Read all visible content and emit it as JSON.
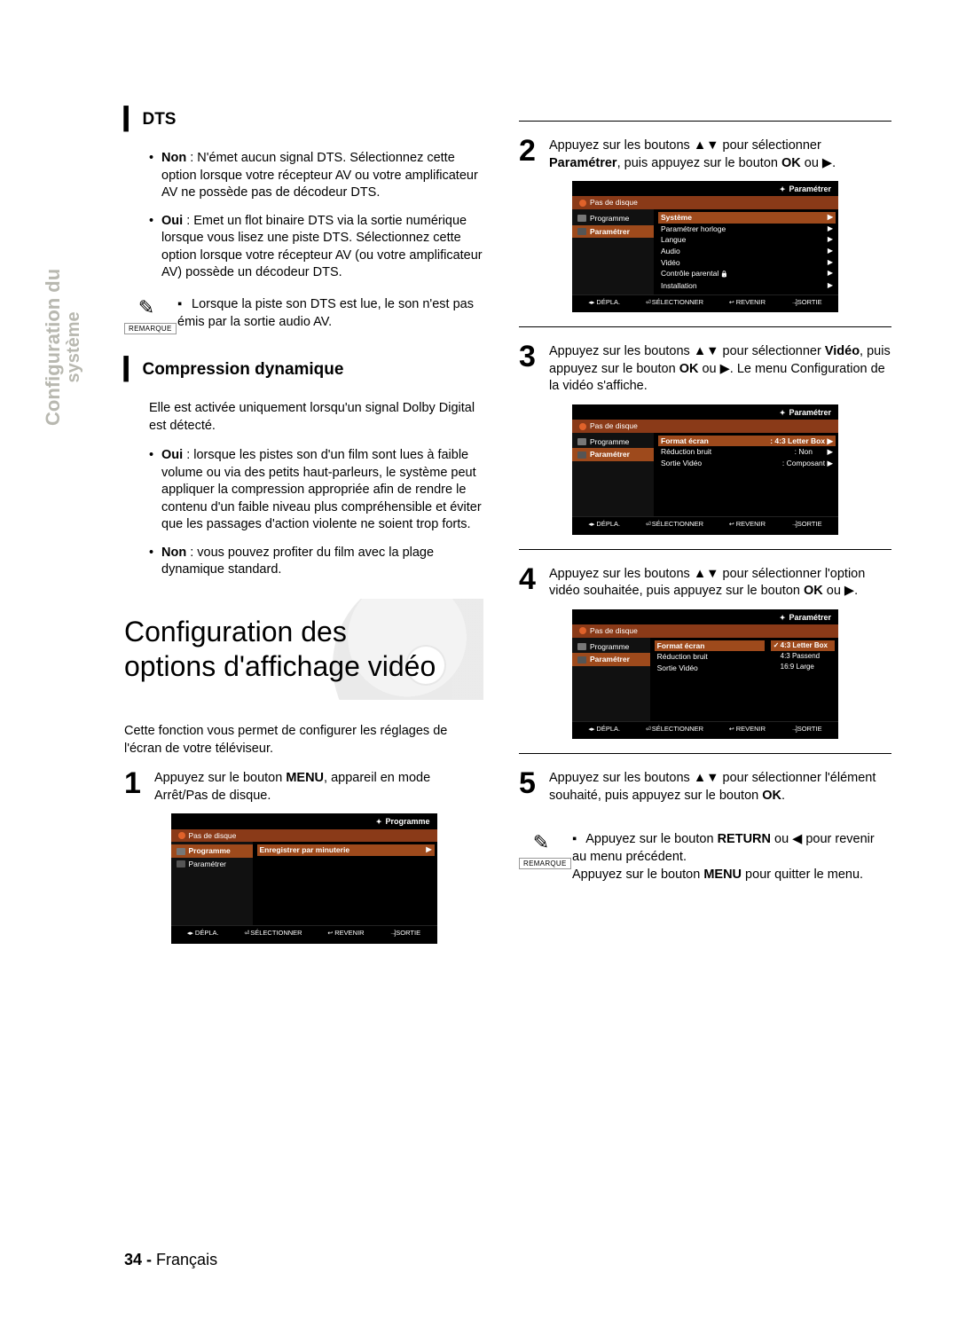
{
  "side_tab": {
    "line1": "Conﬁguration du",
    "line2": "système"
  },
  "left": {
    "dts_heading": "DTS",
    "dts_non_label": "Non",
    "dts_non_text": ": N'émet aucun signal DTS. Sélectionnez cette option lorsque votre récepteur AV ou votre ampliﬁcateur AV ne possède pas de décodeur DTS.",
    "dts_oui_label": "Oui",
    "dts_oui_text": ": Emet un ﬂot binaire DTS via la sortie numérique lorsque vous lisez une piste DTS. Sélectionnez cette option lorsque votre récepteur AV (ou votre ampliﬁcateur AV) possède un décodeur DTS.",
    "note_label": "REMARQUE",
    "dts_note": "Lorsque la piste son DTS est lue, le son n'est pas émis par la sortie audio AV.",
    "comp_heading": "Compression dynamique",
    "comp_intro": "Elle est activée uniquement lorsqu'un signal Dolby Digital est détecté.",
    "comp_oui_label": "Oui",
    "comp_oui_text": ": lorsque les pistes son d'un ﬁlm sont lues à faible volume ou via des petits haut-parleurs, le système peut appliquer la compression appropriée aﬁn de rendre le contenu d'un faible niveau plus compréhensible et éviter que les passages d'action violente ne soient trop forts.",
    "comp_non_label": "Non",
    "comp_non_text": ": vous pouvez proﬁter du ﬁlm avec la plage dynamique standard.",
    "big_title_l1": "Conﬁguration des",
    "big_title_l2": "options d'afﬁchage vidéo",
    "intro_text": "Cette fonction vous permet de conﬁgurer les réglages de l'écran de votre téléviseur.",
    "step1_pre": "Appuyez sur le bouton ",
    "step1_bold": "MENU",
    "step1_post": ", appareil en mode Arrêt/Pas de disque."
  },
  "right": {
    "step2_pre": "Appuyez sur les boutons ▲▼ pour sélectionner ",
    "step2_b1": "Paramétrer",
    "step2_mid": ", puis appuyez sur le bouton ",
    "step2_b2": "OK",
    "step2_post": " ou ▶.",
    "step3_pre": "Appuyez sur les boutons ▲▼ pour sélectionner ",
    "step3_b1": "Vidéo",
    "step3_mid": ", puis appuyez sur le bouton ",
    "step3_b2": "OK",
    "step3_post": " ou ▶. Le menu Conﬁguration de la vidéo s'afﬁche.",
    "step4_pre": "Appuyez sur les boutons ▲▼ pour sélectionner l'option vidéo souhaitée, puis appuyez sur le bouton ",
    "step4_b1": "OK",
    "step4_post": " ou ▶.",
    "step5_pre": "Appuyez sur les boutons ▲▼ pour sélectionner l'élément souhaité, puis appuyez sur le bouton ",
    "step5_b1": "OK",
    "step5_post": ".",
    "note_l1_pre": "Appuyez sur le bouton ",
    "note_l1_b": "RETURN",
    "note_l1_post": " ou ◀ pour revenir au menu précédent.",
    "note_l2_pre": "Appuyez sur le bouton ",
    "note_l2_b": "MENU",
    "note_l2_post": " pour quitter le menu."
  },
  "osd_common": {
    "status": "Pas de disque",
    "side_programme": "Programme",
    "side_parametrer": "Paramétrer",
    "foot_depla": "DÉPLA.",
    "foot_sel": "SÉLECTIONNER",
    "foot_rev": "REVENIR",
    "foot_sortie": "SORTIE"
  },
  "osd1": {
    "header": "Programme",
    "row1": "Enregistrer par minuterie"
  },
  "osd2": {
    "header": "Paramétrer",
    "r1": "Système",
    "r2": "Paramétrer horloge",
    "r3": "Langue",
    "r4": "Audio",
    "r5": "Vidéo",
    "r6": "Contrôle parental",
    "r7": "Installation"
  },
  "osd3": {
    "header": "Paramétrer",
    "r1": "Format écran",
    "v1": "4:3 Letter Box",
    "r2": "Réduction bruit",
    "v2": "Non",
    "r3": "Sortie Vidéo",
    "v3": "Composant"
  },
  "osd4": {
    "header": "Paramétrer",
    "r1": "Format écran",
    "r2": "Réduction bruit",
    "r3": "Sortie Vidéo",
    "o1": "4:3 Letter Box",
    "o2": "4:3 Passend",
    "o3": "16:9 Large"
  },
  "footer": {
    "page": "34 -",
    "lang": "Français"
  }
}
